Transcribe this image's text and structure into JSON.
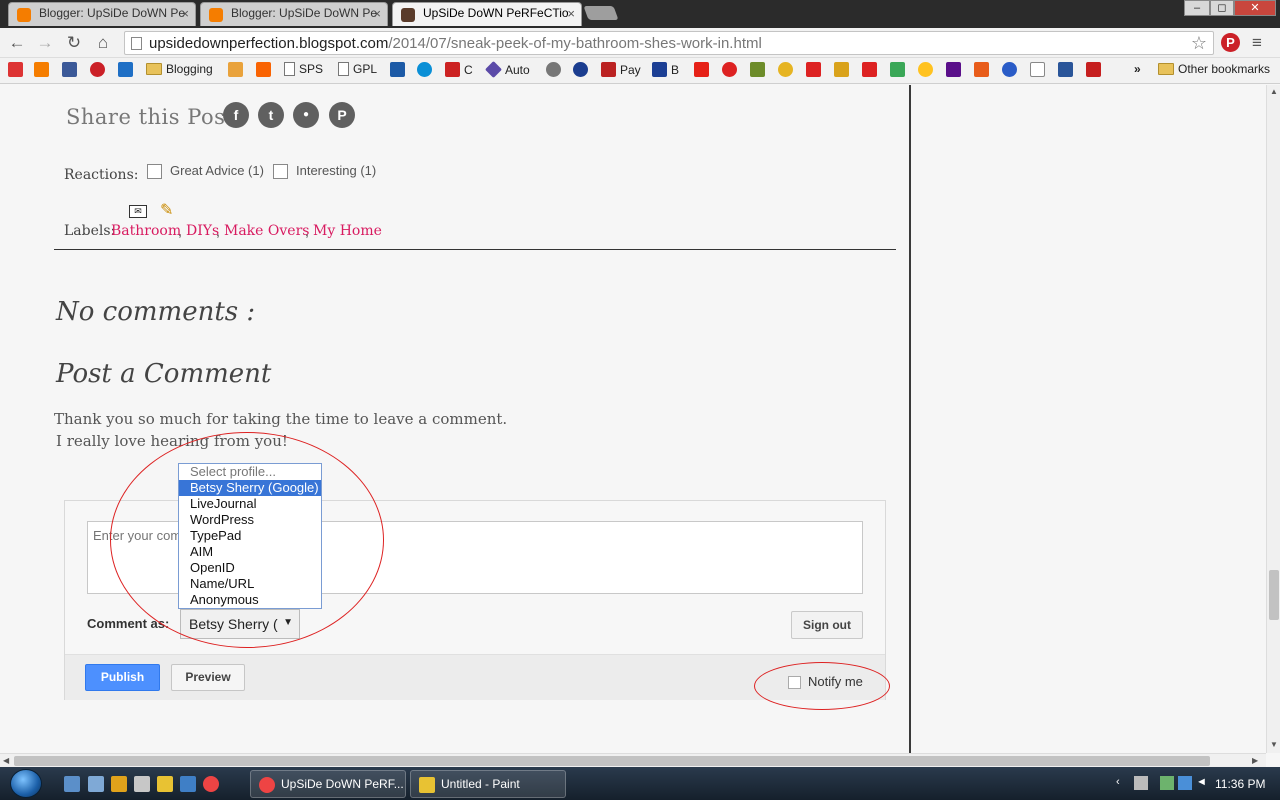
{
  "browser": {
    "tabs": [
      {
        "title": "Blogger: UpSiDe DoWN Pe"
      },
      {
        "title": "Blogger: UpSiDe DoWN Pe"
      },
      {
        "title": "UpSiDe DoWN PeRFeCTio"
      }
    ],
    "window_controls": {
      "minimize": "–",
      "maximize": "◻",
      "close": "✕"
    },
    "url_host": "upsidedownperfection.blogspot.com",
    "url_path": "/2014/07/sneak-peek-of-my-bathroom-shes-work-in.html",
    "bookmarks": {
      "blogging": "Blogging",
      "sps": "SPS",
      "gpl": "GPL",
      "c": "C",
      "auto": "Auto",
      "pay": "Pay",
      "b": "B",
      "overflow": "»",
      "other": "Other bookmarks"
    }
  },
  "post": {
    "share_label": "Share this Post:",
    "share_buttons": [
      {
        "icon": "facebook-icon",
        "glyph": "f"
      },
      {
        "icon": "twitter-icon",
        "glyph": "t"
      },
      {
        "icon": "comment-icon",
        "glyph": "●"
      },
      {
        "icon": "pinterest-icon",
        "glyph": "P"
      }
    ],
    "reactions_label": "Reactions:",
    "reactions": [
      {
        "label": "Great Advice (1)"
      },
      {
        "label": "Interesting (1)"
      }
    ],
    "email_icon_glyph": "✉",
    "edit_icon_glyph": "✎",
    "labels_prefix": "Labels:",
    "labels": [
      "Bathroom",
      "DIYs",
      "Make Overs",
      "My Home"
    ],
    "label_separator": ","
  },
  "comments": {
    "no_comments": "No comments :",
    "post_title": "Post a Comment",
    "thanks_line1": "Thank you so much for taking the time to leave a comment.",
    "thanks_line2": "I really love hearing from you!",
    "textarea_placeholder": "Enter your comment...",
    "comment_as_label": "Comment as:",
    "selected_profile": "Betsy Sherry (",
    "select_arrow": "▼",
    "sign_out_label": "Sign out",
    "publish_label": "Publish",
    "preview_label": "Preview",
    "notify_label": "Notify me",
    "dropdown_options": [
      "Select profile...",
      "Betsy Sherry (Google)",
      "LiveJournal",
      "WordPress",
      "TypePad",
      "AIM",
      "OpenID",
      "Name/URL",
      "Anonymous"
    ],
    "dropdown_selected_index": 1
  },
  "taskbar": {
    "tasks": [
      {
        "label": "UpSiDe DoWN PeRF..."
      },
      {
        "label": "Untitled - Paint"
      }
    ],
    "clock": "11:36 PM"
  },
  "colors": {
    "label_link": "#d81b60",
    "annotation": "#dd2222",
    "publish": "#4d90fe"
  }
}
